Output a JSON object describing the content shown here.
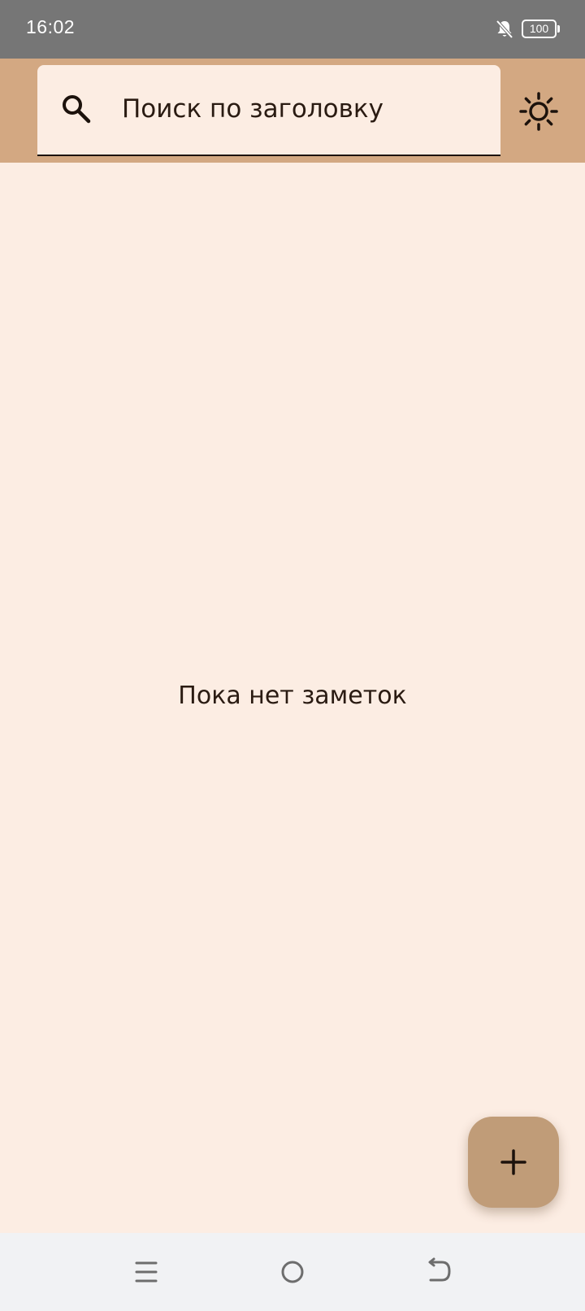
{
  "status_bar": {
    "time": "16:02",
    "battery_level": "100",
    "icons": [
      "bell-off-icon",
      "battery-icon"
    ]
  },
  "search": {
    "placeholder": "Поиск по заголовку",
    "icon": "search-icon"
  },
  "theme_toggle": {
    "icon": "sun-icon"
  },
  "empty_state": {
    "text": "Пока нет заметок"
  },
  "fab": {
    "icon": "plus-icon"
  },
  "nav_bar": {
    "buttons": [
      "menu-icon",
      "home-icon",
      "back-icon"
    ]
  },
  "colors": {
    "status_bar_bg": "#767676",
    "app_bar_bg": "#d3a882",
    "background": "#fcede3",
    "fab_bg": "#c09c78",
    "text": "#2a1b12",
    "nav_bar_bg": "#f1f2f4"
  }
}
